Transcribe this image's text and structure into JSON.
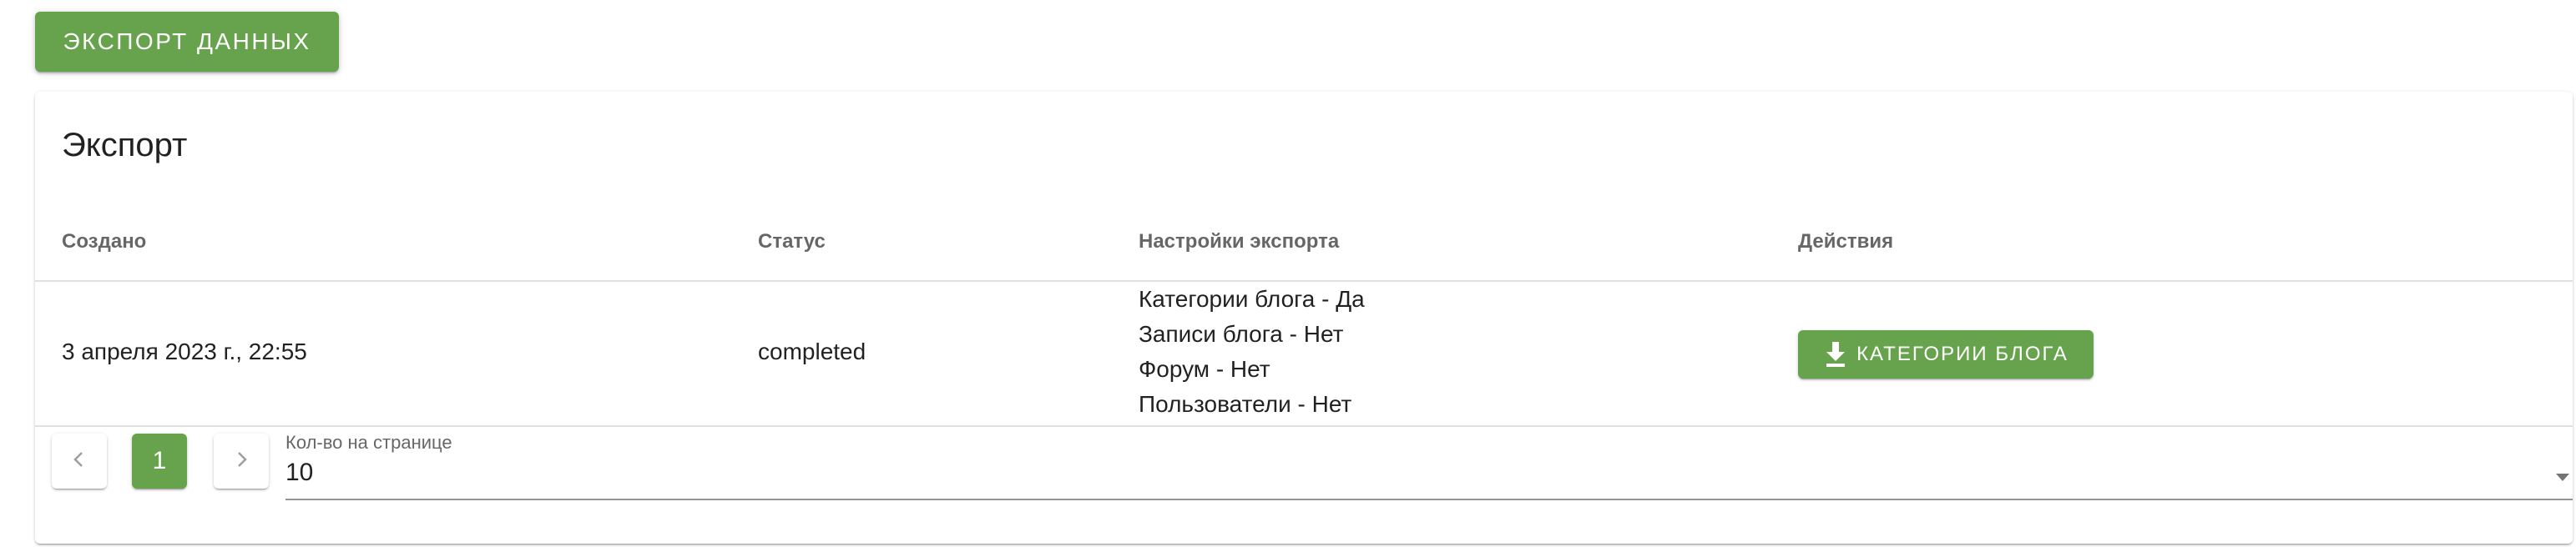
{
  "header": {
    "export_button_label": "ЭКСПОРТ ДАННЫХ"
  },
  "card": {
    "title": "Экспорт",
    "columns": [
      "Создано",
      "Статус",
      "Настройки экспорта",
      "Действия"
    ],
    "rows": [
      {
        "created": "3 апреля 2023 г., 22:55",
        "status": "completed",
        "settings": [
          "Категории блога - Да",
          "Записи блога - Нет",
          "Форум - Нет",
          "Пользователи - Нет"
        ],
        "action_label": "КАТЕГОРИИ БЛОГА",
        "action_icon": "download-icon"
      }
    ]
  },
  "pagination": {
    "prev_icon": "chevron-left-icon",
    "next_icon": "chevron-right-icon",
    "current_page": "1",
    "per_page_label": "Кол-во на странице",
    "per_page_value": "10",
    "dropdown_icon": "arrow-drop-down-icon"
  },
  "colors": {
    "accent": "#67a34c"
  }
}
